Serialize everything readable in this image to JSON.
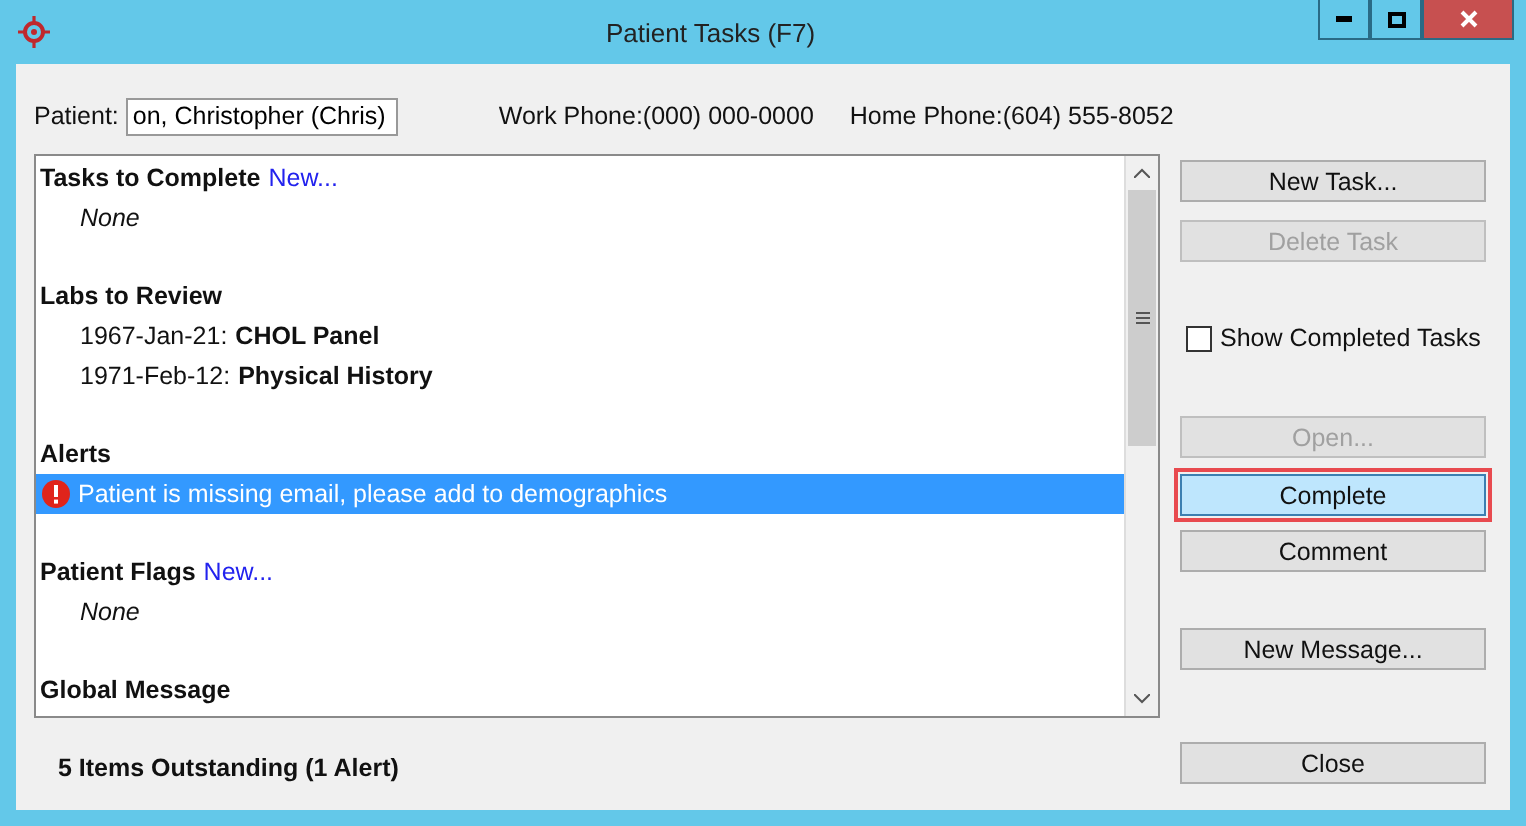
{
  "window": {
    "title": "Patient Tasks (F7)"
  },
  "patient": {
    "label": "Patient:",
    "value": "on, Christopher (Chris)",
    "work_phone": "Work Phone:(000) 000-0000",
    "home_phone": "Home Phone:(604) 555-8052"
  },
  "sections": [
    {
      "title": "Tasks to Complete",
      "link": "New...",
      "items": [
        {
          "kind": "none",
          "text": "None",
          "selected": false
        }
      ]
    },
    {
      "title": "Labs to Review",
      "items": [
        {
          "kind": "lab",
          "date": "1967-Jan-21:",
          "name": "CHOL Panel",
          "selected": false
        },
        {
          "kind": "lab",
          "date": "1971-Feb-12:",
          "name": "Physical History",
          "selected": false
        }
      ]
    },
    {
      "title": "Alerts",
      "items": [
        {
          "kind": "alert",
          "text": "Patient is missing email, please add to demographics",
          "selected": true
        }
      ]
    },
    {
      "title": "Patient Flags",
      "link": "New...",
      "items": [
        {
          "kind": "none",
          "text": "None",
          "selected": false
        }
      ]
    },
    {
      "title": "Global Message"
    }
  ],
  "buttons": [
    {
      "kind": "button",
      "label": "New Task...",
      "disabled": false,
      "highlighted": false
    },
    {
      "kind": "button",
      "label": "Delete Task",
      "disabled": true,
      "highlighted": false
    },
    {
      "kind": "checkbox",
      "label": "Show Completed Tasks",
      "checked": false
    },
    {
      "kind": "button",
      "label": "Open...",
      "disabled": true,
      "highlighted": false
    },
    {
      "kind": "button",
      "label": "Complete",
      "disabled": false,
      "highlighted": true
    },
    {
      "kind": "button",
      "label": "Comment",
      "disabled": false,
      "highlighted": false
    },
    {
      "kind": "button",
      "label": "New Message...",
      "disabled": false,
      "highlighted": false
    }
  ],
  "status": "5 Items Outstanding (1 Alert)",
  "close_button": {
    "label": "Close"
  }
}
